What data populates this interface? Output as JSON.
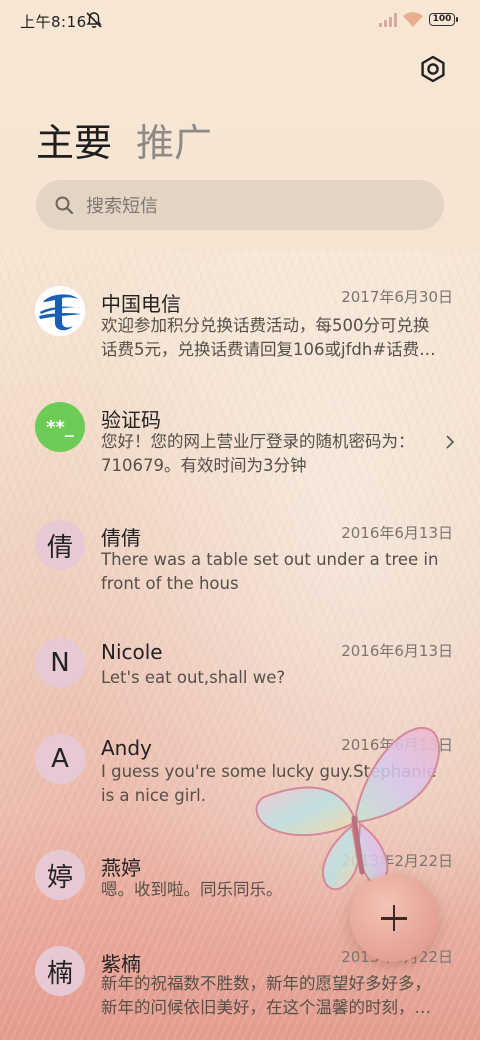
{
  "status_bar": {
    "time": "上午8:16",
    "battery": "100"
  },
  "tabs": [
    {
      "label": "主要",
      "active": true
    },
    {
      "label": "推广",
      "active": false
    }
  ],
  "search": {
    "placeholder": "搜索短信"
  },
  "conversations": [
    {
      "name": "中国电信",
      "date": "2017年6月30日",
      "preview_line1": "欢迎参加积分兑换话费活动，每500分可兑换",
      "preview_line2": "话费5元，兑换话费请回复106或jfdh#话费…",
      "avatar_type": "telecom-logo"
    },
    {
      "name": "验证码",
      "date": "",
      "preview_line1": "您好！您的网上营业厅登录的随机密码为：",
      "preview_line2": "710679。有效时间为3分钟",
      "avatar_text": "**_",
      "avatar_type": "code"
    },
    {
      "name": "倩倩",
      "date": "2016年6月13日",
      "avatar_text": "倩",
      "preview_line1": "There was a table set out under a tree in",
      "preview_line2": "front of the hous"
    },
    {
      "name": "Nicole",
      "date": "2016年6月13日",
      "avatar_text": "N",
      "preview_line1": "Let's eat out,shall we?",
      "preview_line2": ""
    },
    {
      "name": "Andy",
      "date": "2016年6月13日",
      "avatar_text": "A",
      "preview_line1": "I guess you're some lucky guy.Stephanie",
      "preview_line2": "is a nice girl."
    },
    {
      "name": "燕婷",
      "date": "2013年2月22日",
      "avatar_text": "婷",
      "preview_line1": "嗯。收到啦。同乐同乐。",
      "preview_line2": ""
    },
    {
      "name": "紫楠",
      "date": "2013年2月22日",
      "avatar_text": "楠",
      "preview_line1": "新年的祝福数不胜数，新年的愿望好多好多，",
      "preview_line2": "新年的问候依旧美好，在这个温馨的时刻，…"
    }
  ],
  "colors": {
    "code_avatar": "#6ccc55",
    "telecom_blue": "#1a5fb4",
    "avatar_pink": "#e6c9d4"
  }
}
